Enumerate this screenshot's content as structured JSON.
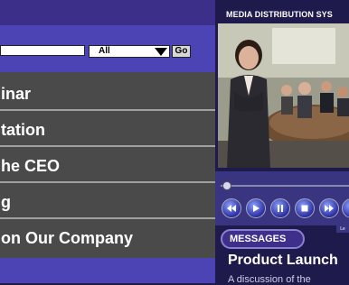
{
  "search": {
    "input_value": "",
    "category_selected": "All",
    "go_label": "Go"
  },
  "menu": {
    "items": [
      "inar",
      "tation",
      "he CEO",
      "g",
      "on Our Company"
    ]
  },
  "right_panel": {
    "title": "MEDIA DISTRIBUTION SYS"
  },
  "player": {
    "progress": 0.05
  },
  "messages": {
    "tab_label": "MESSAGES",
    "item_title": "Product Launch",
    "item_desc": "A discussion of the",
    "badge": "Le"
  },
  "colors": {
    "panel_purple": "#4c44b4",
    "dark_navy": "#1f1a4c",
    "menu_gray": "#4a4a4a"
  }
}
